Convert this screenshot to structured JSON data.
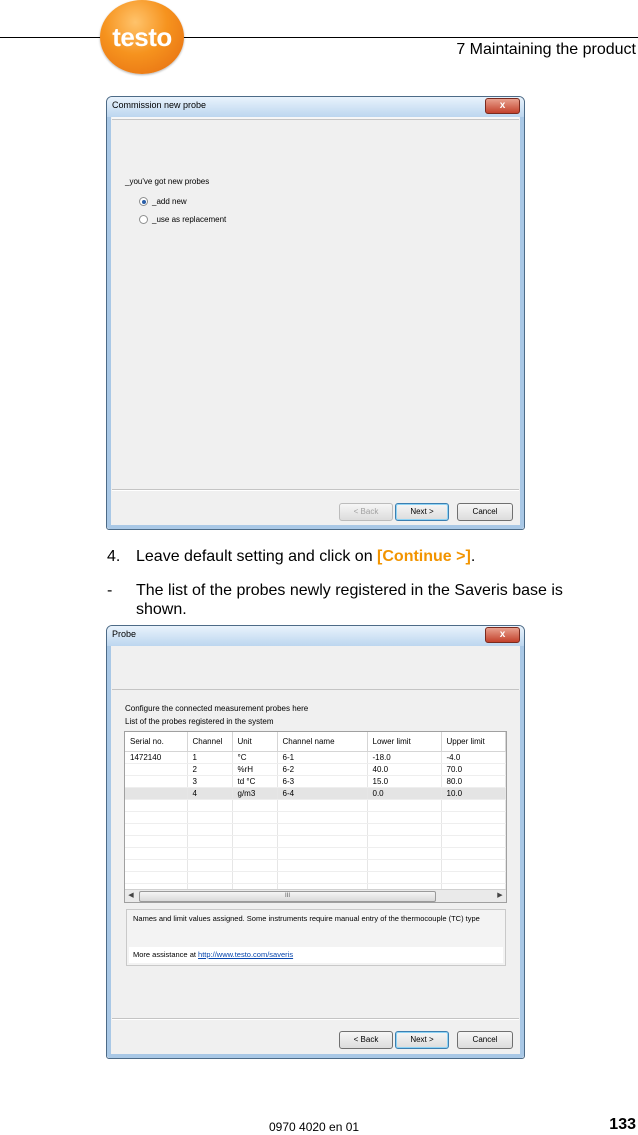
{
  "header": {
    "logo_text": "testo",
    "chapter": "7 Maintaining the product"
  },
  "dialog1": {
    "title": "Commission new probe",
    "close": "x",
    "prompt": "_you've got new probes",
    "options": [
      {
        "label": "_add new",
        "selected": true
      },
      {
        "label": "_use as replacement",
        "selected": false
      }
    ],
    "buttons": {
      "back": "< Back",
      "next": "Next >",
      "cancel": "Cancel"
    }
  },
  "step": {
    "number": "4.",
    "text_before": "Leave default setting and click on ",
    "action": "[Continue >]",
    "text_after": "."
  },
  "result": {
    "bullet": "-",
    "line1": "The list of the probes newly registered in the Saveris base is",
    "line2": "shown."
  },
  "dialog2": {
    "title": "Probe",
    "close": "x",
    "heading1": "Configure the connected measurement probes here",
    "heading2": "List of the probes registered in the system",
    "columns": [
      "Serial no.",
      "Channel",
      "Unit",
      "Channel name",
      "Lower limit",
      "Upper limit"
    ],
    "rows": [
      [
        "1472140",
        "1",
        "°C",
        "6-1",
        "-18.0",
        "-4.0"
      ],
      [
        "",
        "2",
        "%rH",
        "6-2",
        "40.0",
        "70.0"
      ],
      [
        "",
        "3",
        "td °C",
        "6-3",
        "15.0",
        "80.0"
      ],
      [
        "",
        "4",
        "g/m3",
        "6-4",
        "0.0",
        "10.0"
      ]
    ],
    "scroll_grip": "III",
    "info_text": "Names and limit values assigned. Some instruments require manual entry of the thermocouple (TC) type",
    "assist_prefix": "More assistance at ",
    "assist_link": "http://www.testo.com/saveris",
    "buttons": {
      "back": "< Back",
      "next": "Next >",
      "cancel": "Cancel"
    }
  },
  "footer": {
    "doc_code": "0970 4020 en 01",
    "page_number": "133"
  },
  "colors": {
    "accent": "#f29400",
    "link": "#0645ad",
    "logo": "#f6931e"
  }
}
